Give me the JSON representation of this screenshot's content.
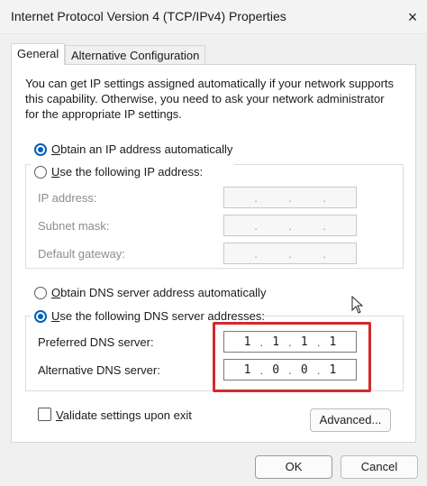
{
  "window": {
    "title": "Internet Protocol Version 4 (TCP/IPv4) Properties",
    "close_icon": "×"
  },
  "tabs": [
    {
      "label": "General",
      "active": true
    },
    {
      "label": "Alternative Configuration",
      "active": false
    }
  ],
  "description": [
    "You can get IP settings assigned automatically if your network supports",
    "this capability. Otherwise, you need to ask your network administrator",
    "for the appropriate IP settings."
  ],
  "ip_section": {
    "auto_label": "Obtain an IP address automatically",
    "auto_selected": true,
    "manual_label": "Use the following IP address:",
    "fields": [
      {
        "label": "IP address:",
        "value": ". . ."
      },
      {
        "label": "Subnet mask:",
        "value": ". . ."
      },
      {
        "label": "Default gateway:",
        "value": ". . ."
      }
    ]
  },
  "dns_section": {
    "auto_label": "Obtain DNS server address automatically",
    "manual_label": "Use the following DNS server addresses:",
    "manual_selected": true,
    "preferred": {
      "label": "Preferred DNS server:",
      "octets": [
        "1",
        "1",
        "1",
        "1"
      ]
    },
    "alternative": {
      "label": "Alternative DNS server:",
      "octets": [
        "1",
        "0",
        "0",
        "1"
      ]
    }
  },
  "validate": {
    "label": "Validate settings upon exit",
    "checked": false
  },
  "buttons": {
    "advanced": "Advanced...",
    "ok": "OK",
    "cancel": "Cancel"
  },
  "colors": {
    "accent": "#005fb8",
    "highlight_box": "#d12b2b"
  }
}
